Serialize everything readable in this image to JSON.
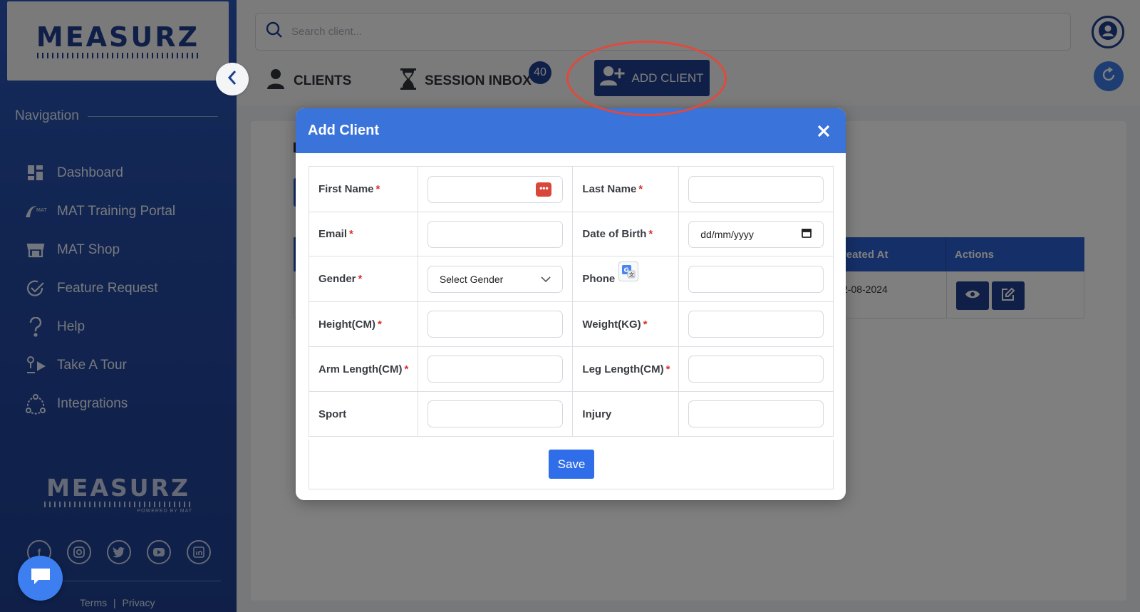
{
  "brand": {
    "logo_text": "MEASURZ",
    "powered_by": "POWERED BY MAT"
  },
  "sidebar": {
    "nav_heading": "Navigation",
    "items": [
      {
        "label": "Dashboard",
        "icon": "dashboard-icon"
      },
      {
        "label": "MAT Training Portal",
        "icon": "mat-logo-icon"
      },
      {
        "label": "MAT Shop",
        "icon": "shop-icon"
      },
      {
        "label": "Feature Request",
        "icon": "check-circle-icon"
      },
      {
        "label": "Help",
        "icon": "question-icon"
      },
      {
        "label": "Take A Tour",
        "icon": "tour-icon"
      },
      {
        "label": "Integrations",
        "icon": "integrations-icon"
      }
    ],
    "socials": [
      "facebook-icon",
      "instagram-icon",
      "twitter-icon",
      "youtube-icon",
      "linkedin-icon"
    ],
    "footer": {
      "terms": "Terms",
      "separator": "|",
      "privacy": "Privacy"
    }
  },
  "header": {
    "search_placeholder": "Search client...",
    "tabs": {
      "clients": "CLIENTS",
      "session_inbox": "SESSION INBOX",
      "session_inbox_count": "40"
    },
    "add_client_label": "ADD CLIENT"
  },
  "background_table": {
    "columns": {
      "created_at": "reated At",
      "actions": "Actions"
    },
    "row": {
      "created_at": "2-08-2024"
    }
  },
  "modal": {
    "title": "Add Client",
    "rows": [
      [
        {
          "label": "First Name",
          "required": "*",
          "value": ""
        },
        {
          "label": "Last Name",
          "required": "*",
          "value": ""
        }
      ],
      [
        {
          "label": "Email",
          "required": "*",
          "value": ""
        },
        {
          "label": "Date of Birth",
          "required": "*",
          "value": "dd/mm/yyyy"
        }
      ],
      [
        {
          "label": "Gender",
          "required": "*",
          "value": "Select Gender"
        },
        {
          "label": "Phone",
          "required": "",
          "value": ""
        }
      ],
      [
        {
          "label": "Height(CM)",
          "required": "*",
          "value": ""
        },
        {
          "label": "Weight(KG)",
          "required": "*",
          "value": ""
        }
      ],
      [
        {
          "label": "Arm Length(CM)",
          "required": "*",
          "value": ""
        },
        {
          "label": "Leg Length(CM)",
          "required": "*",
          "value": ""
        }
      ],
      [
        {
          "label": "Sport",
          "required": "",
          "value": ""
        },
        {
          "label": "Injury",
          "required": "",
          "value": ""
        }
      ]
    ],
    "password_badge": "•••",
    "save_label": "Save"
  },
  "colors": {
    "brand_blue": "#1f3f8f",
    "accent_blue": "#3a73d9",
    "required_red": "#d9302c",
    "highlight_red": "#e04a3c"
  }
}
